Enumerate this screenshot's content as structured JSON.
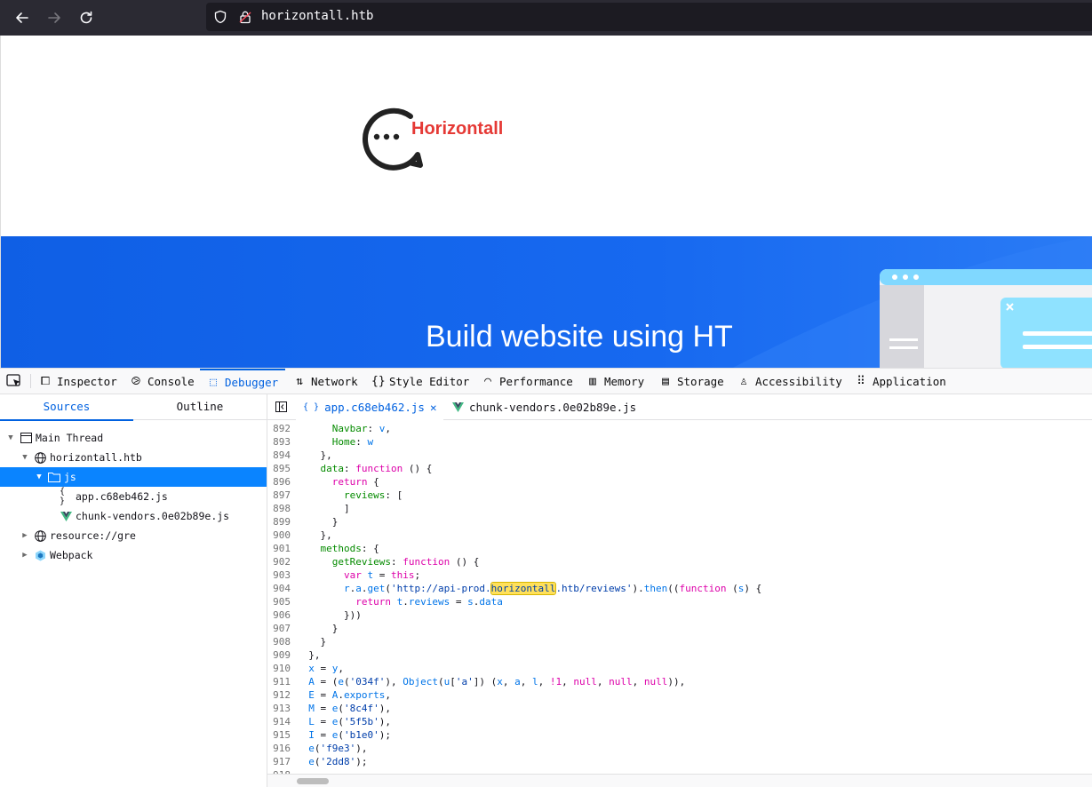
{
  "browser": {
    "url": "horizontall.htb"
  },
  "page": {
    "logo_text": "Horizontall",
    "hero_title": "Build website using HT"
  },
  "devtools": {
    "tabs": [
      {
        "label": "Inspector",
        "icon": "inspector-icon"
      },
      {
        "label": "Console",
        "icon": "console-icon"
      },
      {
        "label": "Debugger",
        "icon": "debugger-icon"
      },
      {
        "label": "Network",
        "icon": "network-icon"
      },
      {
        "label": "Style Editor",
        "icon": "braces-icon"
      },
      {
        "label": "Performance",
        "icon": "gauge-icon"
      },
      {
        "label": "Memory",
        "icon": "memory-icon"
      },
      {
        "label": "Storage",
        "icon": "storage-icon"
      },
      {
        "label": "Accessibility",
        "icon": "accessibility-icon"
      },
      {
        "label": "Application",
        "icon": "grid-icon"
      }
    ],
    "active_tab": "Debugger",
    "sidebar_tabs": [
      "Sources",
      "Outline"
    ],
    "tree": [
      {
        "label": "Main Thread",
        "icon": "window-icon"
      },
      {
        "label": "horizontall.htb",
        "icon": "globe-icon"
      },
      {
        "label": "js",
        "icon": "folder-icon"
      },
      {
        "label": "app.c68eb462.js",
        "icon": "js-file-icon"
      },
      {
        "label": "chunk-vendors.0e02b89e.js",
        "icon": "vue-icon"
      },
      {
        "label": "resource://gre",
        "icon": "globe-icon"
      },
      {
        "label": "Webpack",
        "icon": "webpack-icon"
      }
    ],
    "editor_tabs": [
      {
        "label": "app.c68eb462.js",
        "icon": "js-file-icon"
      },
      {
        "label": "chunk-vendors.0e02b89e.js",
        "icon": "vue-icon"
      }
    ],
    "search_highlight": "horizontall",
    "code_lines": [
      {
        "n": "892",
        "text": "      Navbar: v,"
      },
      {
        "n": "893",
        "text": "      Home: w"
      },
      {
        "n": "894",
        "text": "    },"
      },
      {
        "n": "895",
        "text": "    data: function () {"
      },
      {
        "n": "896",
        "text": "      return {"
      },
      {
        "n": "897",
        "text": "        reviews: ["
      },
      {
        "n": "898",
        "text": "        ]"
      },
      {
        "n": "899",
        "text": "      }"
      },
      {
        "n": "900",
        "text": "    },"
      },
      {
        "n": "901",
        "text": "    methods: {"
      },
      {
        "n": "902",
        "text": "      getReviews: function () {"
      },
      {
        "n": "903",
        "text": "        var t = this;"
      },
      {
        "n": "904",
        "text": "        r.a.get('http://api-prod.horizontall.htb/reviews').then((function (s) {"
      },
      {
        "n": "905",
        "text": "          return t.reviews = s.data"
      },
      {
        "n": "906",
        "text": "        }))"
      },
      {
        "n": "907",
        "text": "      }"
      },
      {
        "n": "908",
        "text": "    }"
      },
      {
        "n": "909",
        "text": "  },"
      },
      {
        "n": "910",
        "text": "  x = y,"
      },
      {
        "n": "911",
        "text": "  A = (e('034f'), Object(u['a']) (x, a, l, !1, null, null, null)),"
      },
      {
        "n": "912",
        "text": "  E = A.exports,"
      },
      {
        "n": "913",
        "text": "  M = e('8c4f'),"
      },
      {
        "n": "914",
        "text": "  L = e('5f5b'),"
      },
      {
        "n": "915",
        "text": "  I = e('b1e0');"
      },
      {
        "n": "916",
        "text": "  e('f9e3'),"
      },
      {
        "n": "917",
        "text": "  e('2dd8');"
      },
      {
        "n": "918",
        "text": ""
      }
    ]
  },
  "colors": {
    "accent": "#0061e0",
    "selection": "#0a84ff",
    "hero_blue": "#1769f0",
    "logo_red": "#e53935",
    "highlight": "#ffe05a"
  }
}
